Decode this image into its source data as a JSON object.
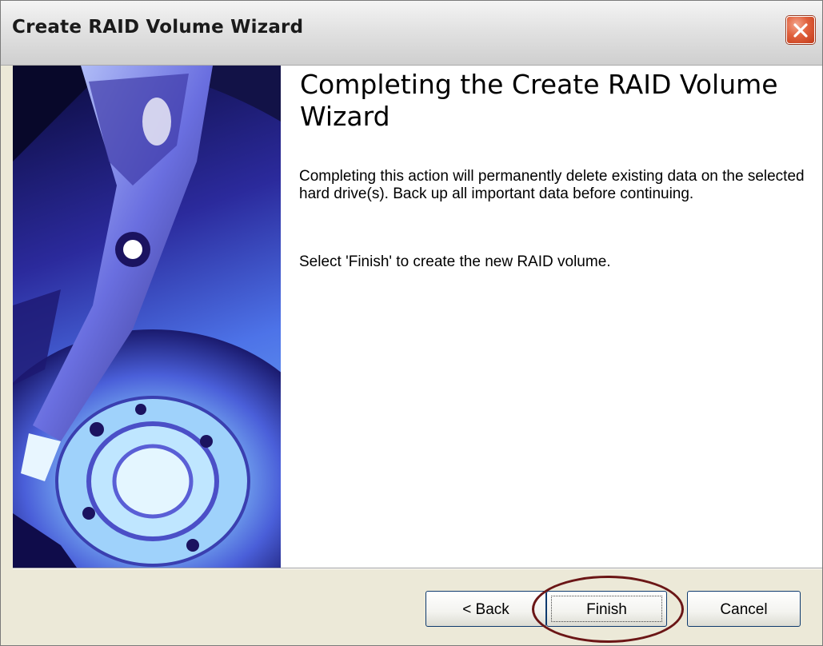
{
  "window": {
    "title": "Create RAID Volume Wizard",
    "close_icon": "close-icon"
  },
  "hero_image": {
    "subject": "hard drive platter and actuator arm"
  },
  "content": {
    "heading": "Completing the Create RAID Volume Wizard",
    "paragraph_1": "Completing this action will permanently delete existing data on the selected hard drive(s). Back up all important data before continuing.",
    "paragraph_2": "Select 'Finish' to create the new RAID volume."
  },
  "buttons": {
    "back": "< Back",
    "finish": "Finish",
    "cancel": "Cancel"
  },
  "colors": {
    "close_button": "#d9532e",
    "highlight_ellipse": "#6b1616",
    "button_border": "#0e3a6e"
  }
}
